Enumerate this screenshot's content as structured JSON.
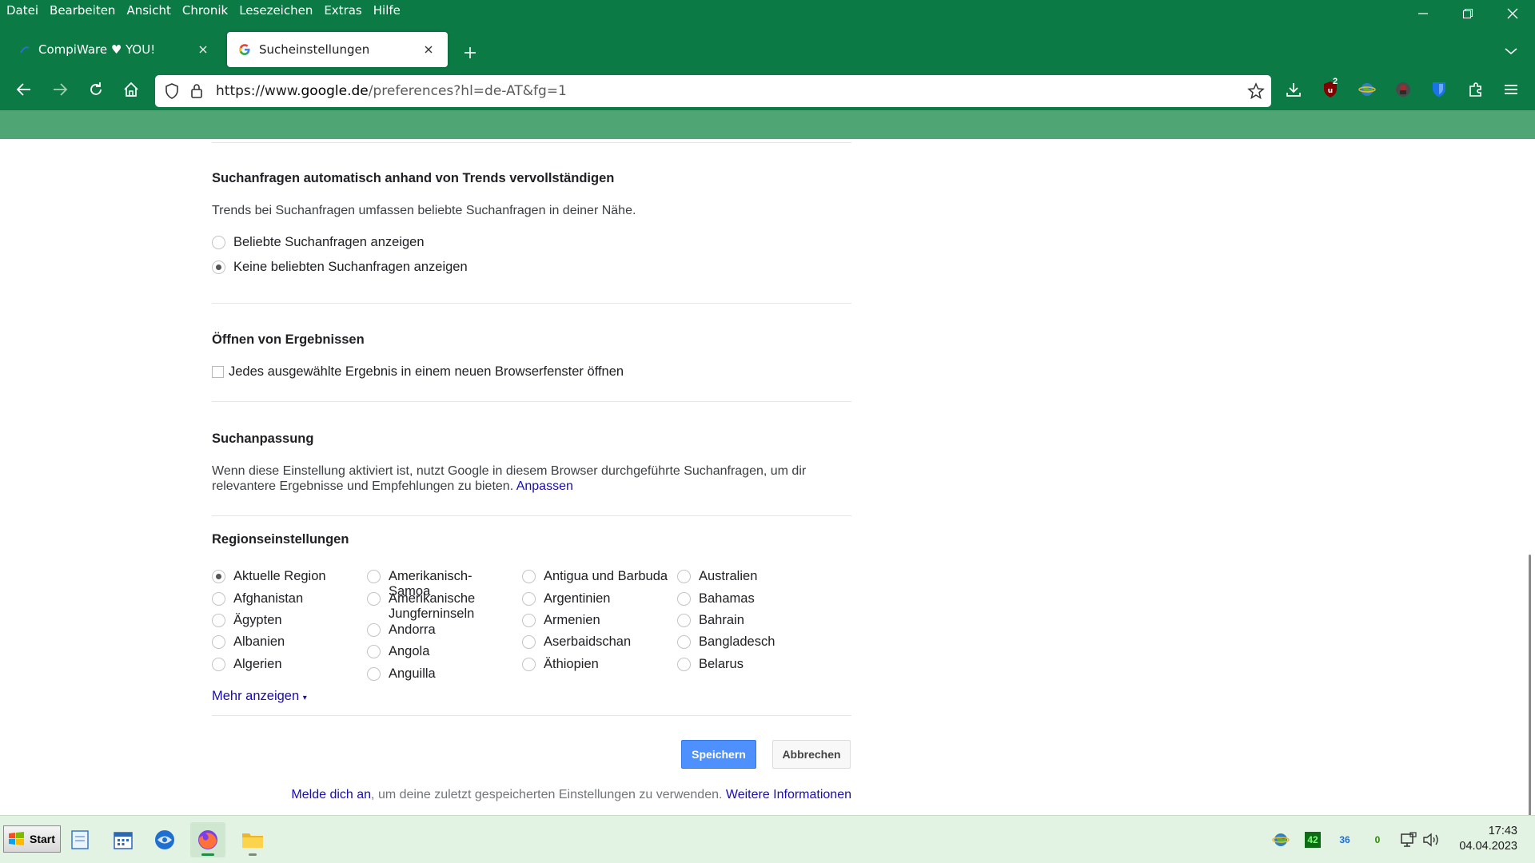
{
  "menubar": [
    "Datei",
    "Bearbeiten",
    "Ansicht",
    "Chronik",
    "Lesezeichen",
    "Extras",
    "Hilfe"
  ],
  "tabs": [
    {
      "label": "CompiWare ♥ YOU!"
    },
    {
      "label": "Sucheinstellungen"
    }
  ],
  "url": {
    "prefix": "https://www.",
    "host": "google.de",
    "path": "/preferences?hl=de-AT&fg=1"
  },
  "extensions": {
    "ublock_badge": "2"
  },
  "trends": {
    "title": "Suchanfragen automatisch anhand von Trends vervollständigen",
    "desc": "Trends bei Suchanfragen umfassen beliebte Suchanfragen in deiner Nähe.",
    "options": [
      "Beliebte Suchanfragen anzeigen",
      "Keine beliebten Suchanfragen anzeigen"
    ],
    "selected_index": 1
  },
  "opening": {
    "title": "Öffnen von Ergebnissen",
    "checkbox_label": "Jedes ausgewählte Ergebnis in einem neuen Browserfenster öffnen"
  },
  "personalization": {
    "title": "Suchanpassung",
    "desc": "Wenn diese Einstellung aktiviert ist, nutzt Google in diesem Browser durchgeführte Suchanfragen, um dir relevantere Ergebnisse und Empfehlungen zu bieten.",
    "link": "Anpassen"
  },
  "region": {
    "title": "Regionseinstellungen",
    "columns": [
      [
        "Aktuelle Region",
        "Afghanistan",
        "Ägypten",
        "Albanien",
        "Algerien"
      ],
      [
        "Amerikanisch-Samoa",
        "Amerikanische Jungferninseln",
        "Andorra",
        "Angola",
        "Anguilla"
      ],
      [
        "Antigua und Barbuda",
        "Argentinien",
        "Armenien",
        "Aserbaidschan",
        "Äthiopien"
      ],
      [
        "Australien",
        "Bahamas",
        "Bahrain",
        "Bangladesch",
        "Belarus"
      ]
    ],
    "selected": "Aktuelle Region",
    "more": "Mehr anzeigen"
  },
  "buttons": {
    "save": "Speichern",
    "cancel": "Abbrechen"
  },
  "footer": {
    "sign_in": "Melde dich an",
    "middle": ", um deine zuletzt gespeicherten Einstellungen zu verwenden. ",
    "more_info": "Weitere Informationen"
  },
  "taskbar": {
    "start": "Start",
    "tray": {
      "cpu": "42",
      "temp": "36",
      "zero": "0"
    },
    "time": "17:43",
    "date": "04.04.2023"
  },
  "colors": {
    "chrome": "#0b7a45",
    "chrome_bottom": "#4fa674",
    "link": "#1a0dab",
    "save": "#4d90fe"
  }
}
